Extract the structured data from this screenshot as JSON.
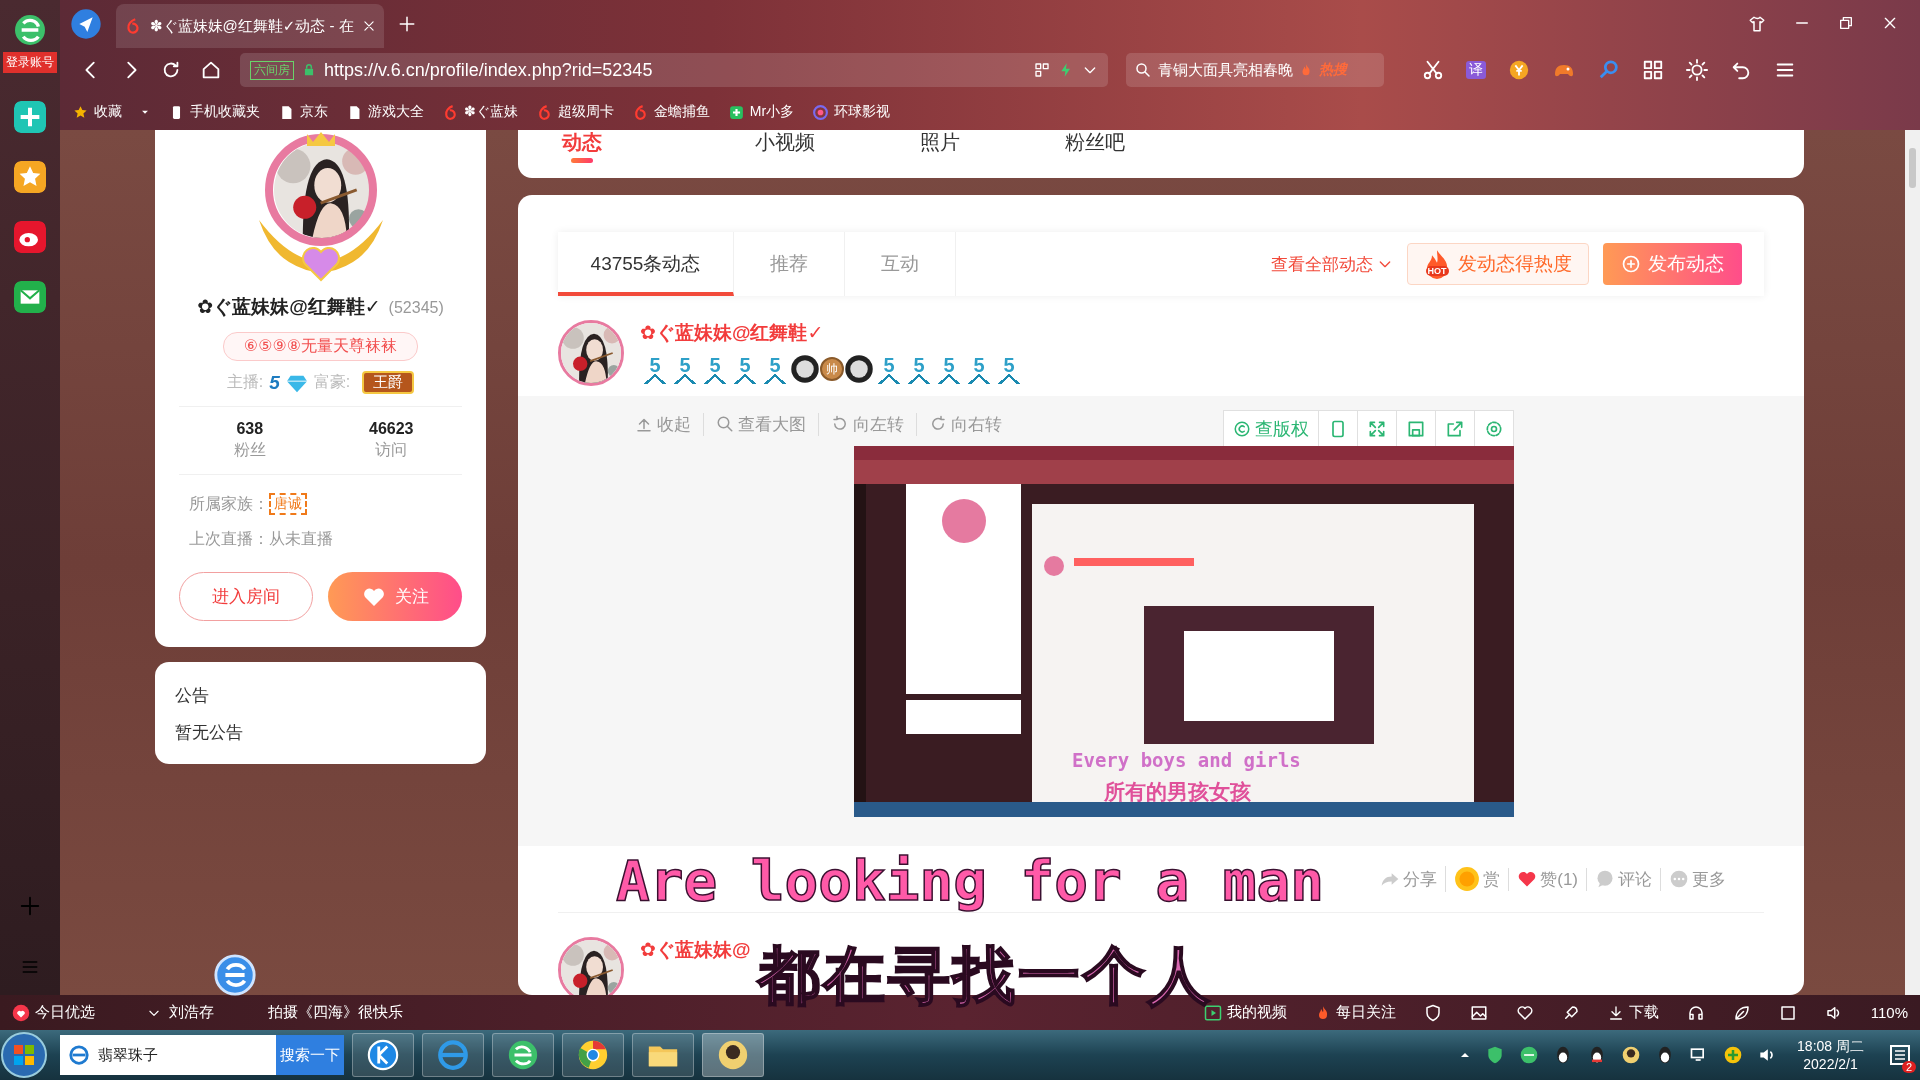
{
  "browser": {
    "tab_title": "✽ぐ蓝妹妹@红舞鞋✓动态 - 在",
    "site_badge": "六间房",
    "url": "https://v.6.cn/profile/index.php?rid=52345",
    "search_text": "青铜大面具亮相春晚",
    "search_tag": "热搜",
    "translate": "译",
    "bookmarks": [
      {
        "label": "收藏",
        "kind": "star"
      },
      {
        "label": "手机收藏夹",
        "kind": "phone"
      },
      {
        "label": "京东",
        "kind": "page"
      },
      {
        "label": "游戏大全",
        "kind": "page"
      },
      {
        "label": "✽ぐ蓝妹",
        "kind": "six"
      },
      {
        "label": "超级周卡",
        "kind": "six"
      },
      {
        "label": "金蟾捕鱼",
        "kind": "six"
      },
      {
        "label": "Mr小多",
        "kind": "green"
      },
      {
        "label": "环球影视",
        "kind": "globe"
      }
    ]
  },
  "dock": {
    "login": "登录账号"
  },
  "profile": {
    "name": "✿ぐ蓝妹妹@红舞鞋✓",
    "id": "(52345)",
    "motto": "⑥⑤⑨⑧无量天尊袜袜",
    "host_label": "主播:",
    "host_level": "5",
    "rich_label": "富豪:",
    "rich_badge": "王爵",
    "stats": [
      {
        "value": "638",
        "label": "粉丝"
      },
      {
        "value": "46623",
        "label": "访问"
      }
    ],
    "family_label": "所属家族：",
    "family": "唐诚",
    "last_live": "上次直播：从未直播",
    "enter_button": "进入房间",
    "follow_button": "关注"
  },
  "notice": {
    "title": "公告",
    "body": "暂无公告"
  },
  "nav_tabs": [
    {
      "label": "动态",
      "selected": true
    },
    {
      "label": "小视频",
      "selected": false
    },
    {
      "label": "照片",
      "selected": false
    },
    {
      "label": "粉丝吧",
      "selected": false
    }
  ],
  "feed": {
    "tabs": [
      {
        "label": "43755条动态",
        "selected": true
      },
      {
        "label": "推荐",
        "selected": false
      },
      {
        "label": "互动",
        "selected": false
      }
    ],
    "view_all": "查看全部动态",
    "hot_badge": "HOT",
    "hot_button": "发动态得热度",
    "publish_button": "发布动态",
    "posts": [
      {
        "author": "✿ぐ蓝妹妹@红舞鞋✓",
        "medals": [
          {
            "kind": "level",
            "text": "5"
          },
          {
            "kind": "level",
            "text": "5"
          },
          {
            "kind": "level",
            "text": "5"
          },
          {
            "kind": "level",
            "text": "5"
          },
          {
            "kind": "level",
            "text": "5"
          },
          {
            "kind": "face"
          },
          {
            "kind": "coin",
            "text": "帅"
          },
          {
            "kind": "face"
          },
          {
            "kind": "level",
            "text": "5"
          },
          {
            "kind": "level",
            "text": "5"
          },
          {
            "kind": "level",
            "text": "5"
          },
          {
            "kind": "level",
            "text": "5"
          },
          {
            "kind": "level",
            "text": "5"
          }
        ],
        "image_tools": [
          {
            "kind": "collapse",
            "label": "收起"
          },
          {
            "kind": "zoom",
            "label": "查看大图"
          },
          {
            "kind": "rotate-left",
            "label": "向左转"
          },
          {
            "kind": "rotate-right",
            "label": "向右转"
          }
        ],
        "copyright": "查版权",
        "image_captions": [
          "Every boys and girls",
          "所有的男孩女孩"
        ],
        "actions": [
          {
            "kind": "share",
            "label": "分享"
          },
          {
            "kind": "reward",
            "label": "赏"
          },
          {
            "kind": "like",
            "label": "赞(1)"
          },
          {
            "kind": "comment",
            "label": "评论"
          },
          {
            "kind": "more",
            "label": "更多"
          }
        ]
      },
      {
        "author": "✿ぐ蓝妹妹@"
      }
    ]
  },
  "subtitles": [
    "Are looking for a man",
    "都在寻找一个人"
  ],
  "status_bar": {
    "today": "今日优选",
    "news": [
      "刘浩存",
      "拍摄《四海》很快乐"
    ],
    "my_video": "我的视频",
    "daily": "每日关注",
    "download": "下载",
    "zoom": "110%"
  },
  "taskbar": {
    "search": "翡翠珠子",
    "search_button": "搜索一下",
    "time": "18:08 周二",
    "date": "2022/2/1",
    "notifications": "2"
  }
}
